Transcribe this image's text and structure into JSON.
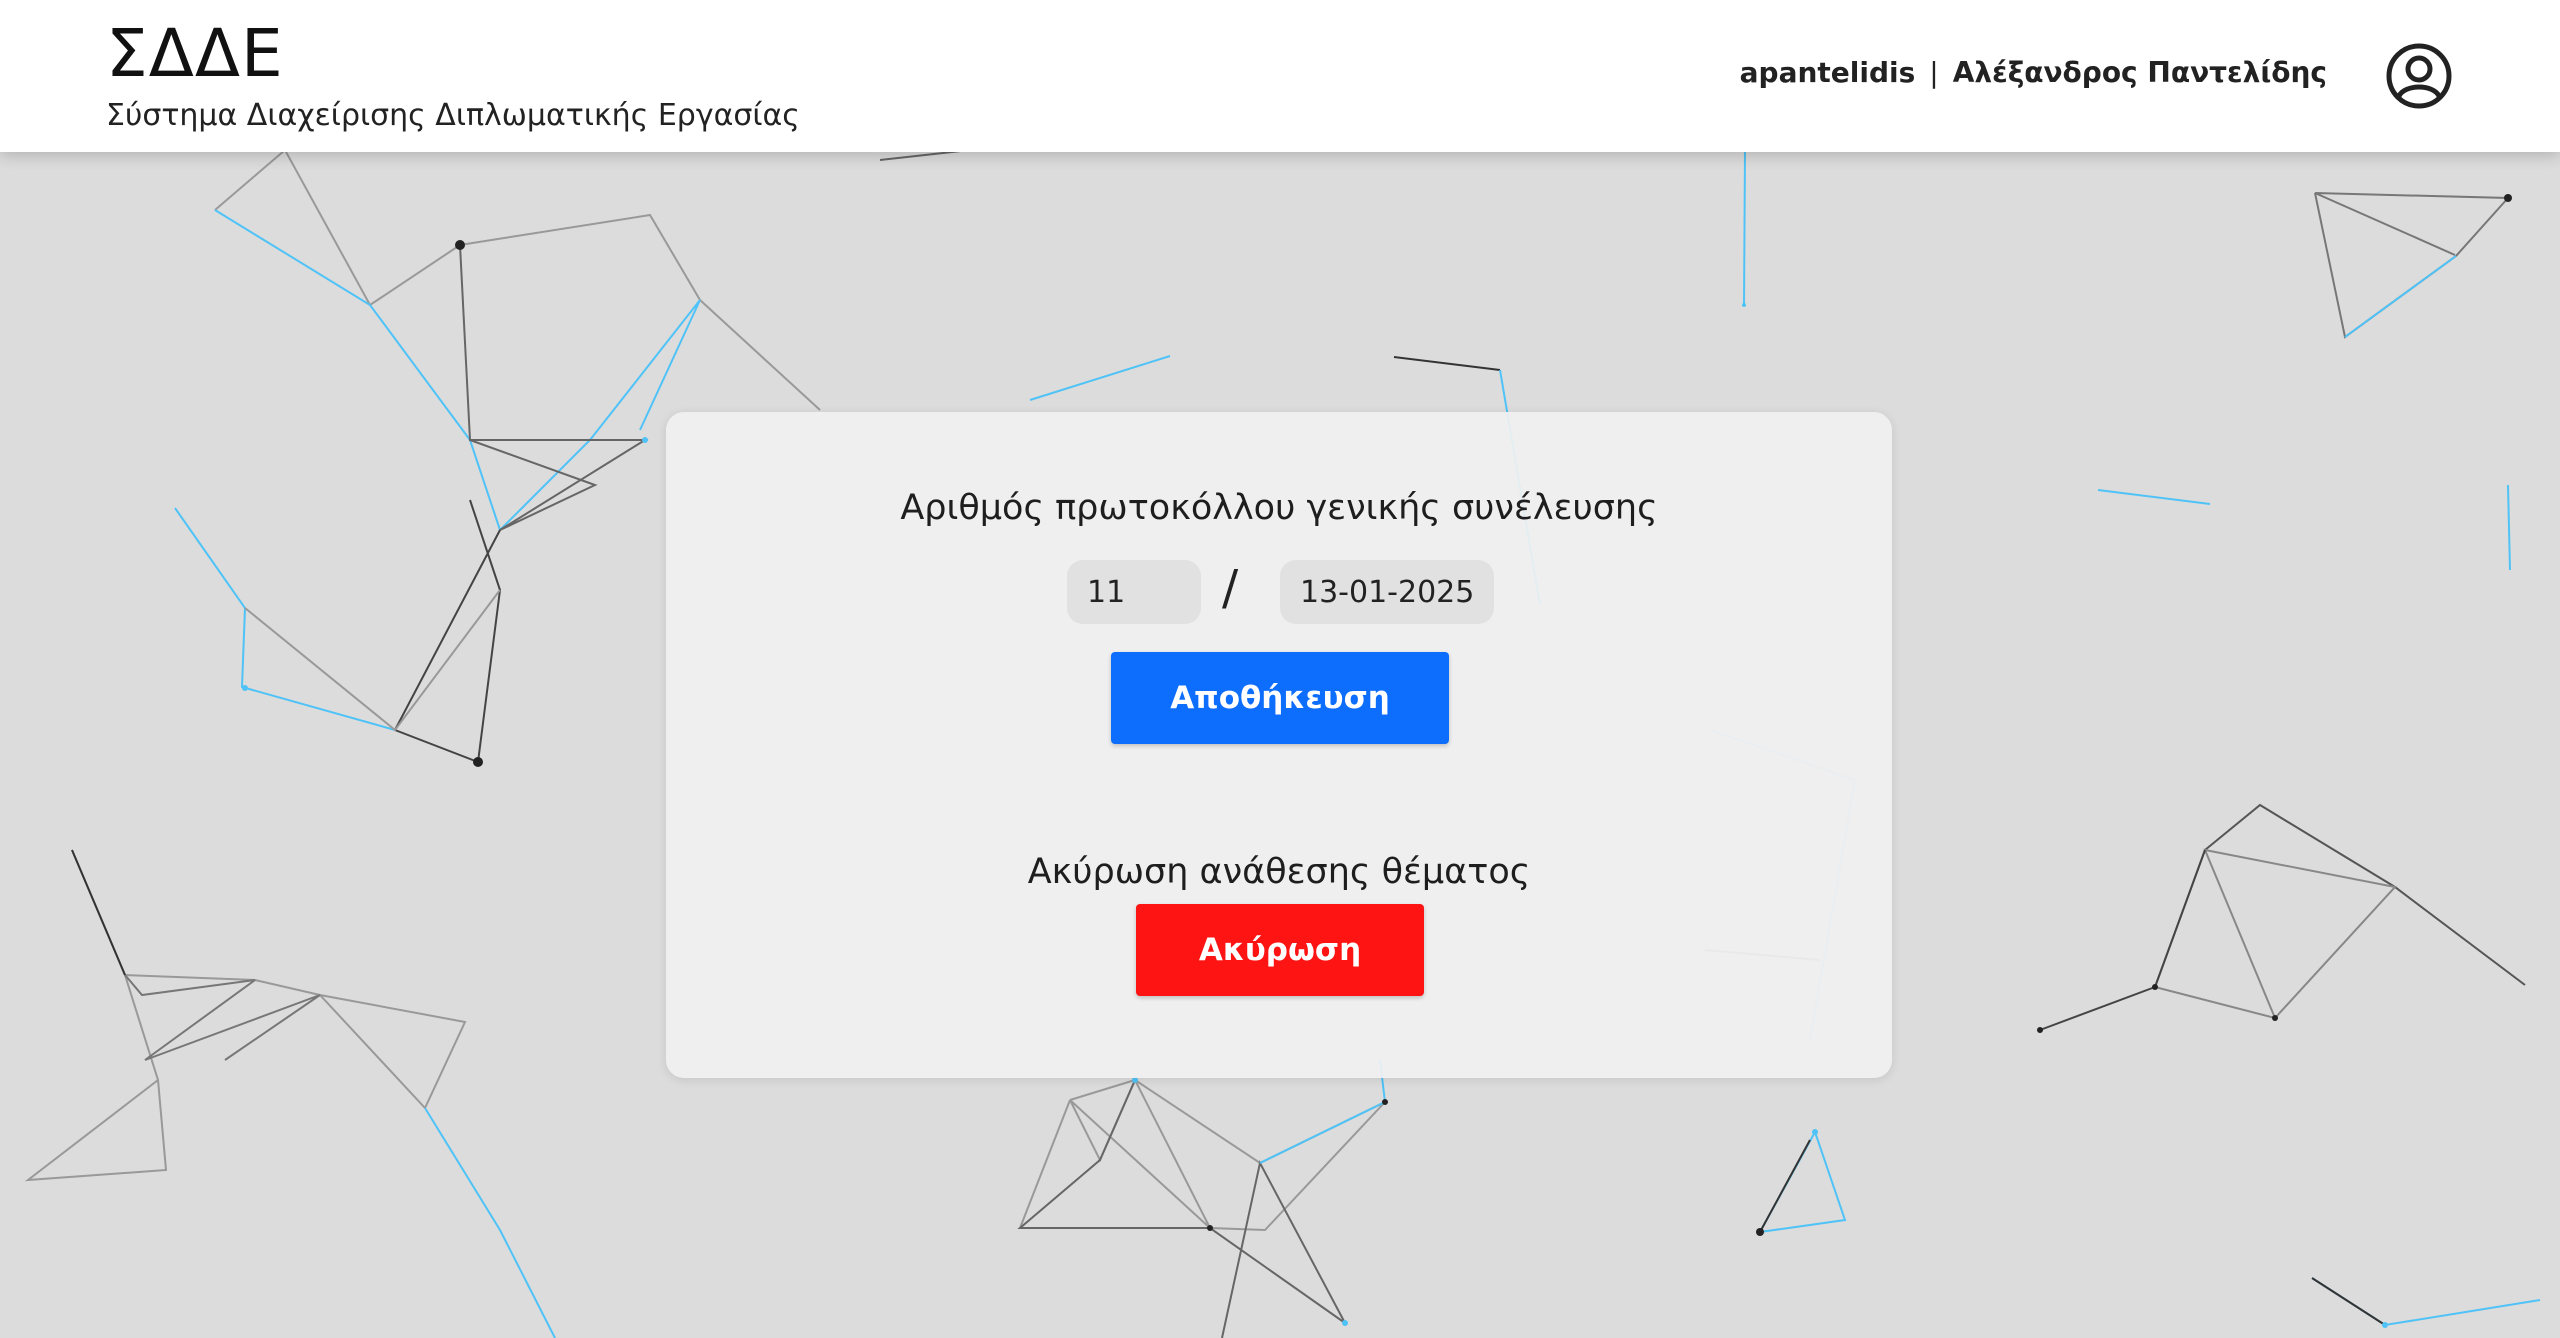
{
  "header": {
    "title": "ΣΔΔΕ",
    "subtitle": "Σύστημα Διαχείρισης Διπλωματικής Εργασίας",
    "username": "apantelidis",
    "separator": "|",
    "full_name": "Αλέξανδρος Παντελίδης",
    "avatar_icon": "user-circle-icon"
  },
  "protocol": {
    "label": "Αριθμός πρωτοκόλλου γενικής συνέλευσης",
    "number_value": "11",
    "separator": "/",
    "date_value": "13-01-2025",
    "save_label": "Αποθήκευση"
  },
  "cancellation": {
    "label": "Ακύρωση ανάθεσης θέματος",
    "cancel_label": "Ακύρωση"
  },
  "colors": {
    "primary": "#0d6efd",
    "danger": "#ff1414",
    "background": "#dcdcdc",
    "network_blue": "#4fc3f7",
    "network_dark": "#222222"
  }
}
